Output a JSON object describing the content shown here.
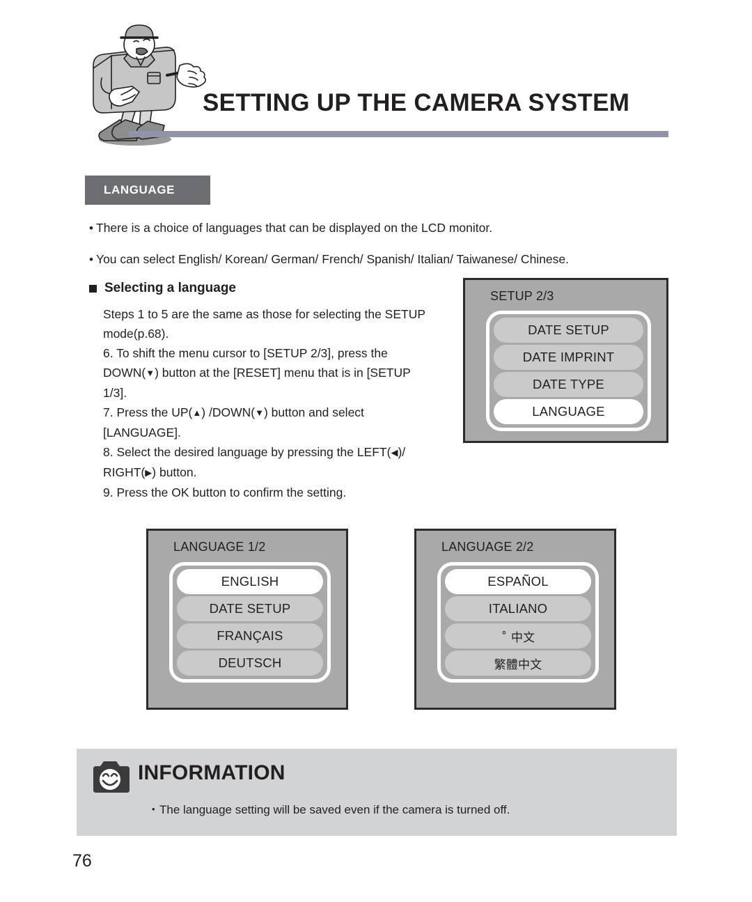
{
  "header": {
    "title": "SETTING UP THE CAMERA SYSTEM",
    "mascot_icon": "camera-mascot-illustration",
    "rule_color": "#8f94a8"
  },
  "section": {
    "badge_label": "LANGUAGE",
    "badge_bg": "#6d6e71",
    "badge_text_color": "#ffffff"
  },
  "intro": {
    "bullets": [
      "There is a choice of languages that can be displayed on the LCD monitor.",
      "You can select English/ Korean/ German/ French/ Spanish/ Italian/ Taiwanese/ Chinese."
    ]
  },
  "subhead": {
    "label": "Selecting a language"
  },
  "steps": {
    "intro_line1": "Steps 1 to 5 are the same as those for selecting the SETUP",
    "intro_line2": "mode(p.68).",
    "step6_line1": "6. To shift the menu cursor to [SETUP 2/3], press the",
    "step6_line2_a": "DOWN(",
    "step6_line2_glyph": "▼",
    "step6_line2_b": ") button at the [RESET] menu that is in [SETUP",
    "step6_line3": "1/3].",
    "step7_a": "7. Press the UP(",
    "step7_glyph_up": "▲",
    "step7_b": ") /DOWN(",
    "step7_glyph_down": "▼",
    "step7_c": ") button and select",
    "step7_line2": "[LANGUAGE].",
    "step8_a": "8. Select the desired language by pressing the LEFT(",
    "step8_glyph_left": "◀",
    "step8_b": ")/",
    "step8_line2_a": "RIGHT(",
    "step8_glyph_right": "▶",
    "step8_line2_b": ") button.",
    "step9": "9. Press the OK button to confirm the setting."
  },
  "lcd_panels": [
    {
      "id": "setup",
      "title": "SETUP 2/3",
      "items": [
        {
          "label": "DATE SETUP",
          "selected": false
        },
        {
          "label": "DATE IMPRINT",
          "selected": false
        },
        {
          "label": "DATE TYPE",
          "selected": false
        },
        {
          "label": "LANGUAGE",
          "selected": true
        }
      ]
    },
    {
      "id": "language1",
      "title": "LANGUAGE 1/2",
      "items": [
        {
          "label": "ENGLISH",
          "selected": true
        },
        {
          "label": "DATE SETUP",
          "selected": false
        },
        {
          "label": "FRANÇAIS",
          "selected": false
        },
        {
          "label": "DEUTSCH",
          "selected": false
        }
      ]
    },
    {
      "id": "language2",
      "title": "LANGUAGE 2/2",
      "items": [
        {
          "label": "ESPAÑOL",
          "selected": true
        },
        {
          "label": "ITALIANO",
          "selected": false
        },
        {
          "label": "˚   中文",
          "selected": false
        },
        {
          "label": "繁體中文",
          "selected": false
        }
      ]
    }
  ],
  "information": {
    "icon": "camera-smiley-icon",
    "title": "INFORMATION",
    "note": "The language setting will be saved even if the camera is turned off.",
    "background": "#d2d3d5"
  },
  "footer": {
    "page_number": "76"
  }
}
